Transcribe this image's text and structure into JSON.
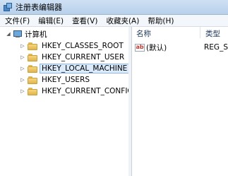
{
  "window": {
    "title": "注册表编辑器",
    "icon": "registry-icon"
  },
  "menu": [
    "文件(F)",
    "编辑(E)",
    "查看(V)",
    "收藏夹(A)",
    "帮助(H)"
  ],
  "tree": {
    "root": {
      "label": "计算机",
      "icon": "computer-icon",
      "expanded": true
    },
    "items": [
      {
        "label": "HKEY_CLASSES_ROOT",
        "icon": "folder-icon",
        "selected": false
      },
      {
        "label": "HKEY_CURRENT_USER",
        "icon": "folder-icon",
        "selected": false
      },
      {
        "label": "HKEY_LOCAL_MACHINE",
        "icon": "folder-icon",
        "selected": true
      },
      {
        "label": "HKEY_USERS",
        "icon": "folder-icon",
        "selected": false
      },
      {
        "label": "HKEY_CURRENT_CONFIG",
        "icon": "folder-icon",
        "selected": false
      }
    ]
  },
  "values_pane": {
    "columns": [
      "名称",
      "类型"
    ],
    "rows": [
      {
        "name": "(默认)",
        "type": "REG_S",
        "icon": "string-value-icon"
      }
    ]
  },
  "colors": {
    "titlebar": "#c4d8ef",
    "selection": "#dcebfc",
    "folder": "#e9c35f"
  }
}
